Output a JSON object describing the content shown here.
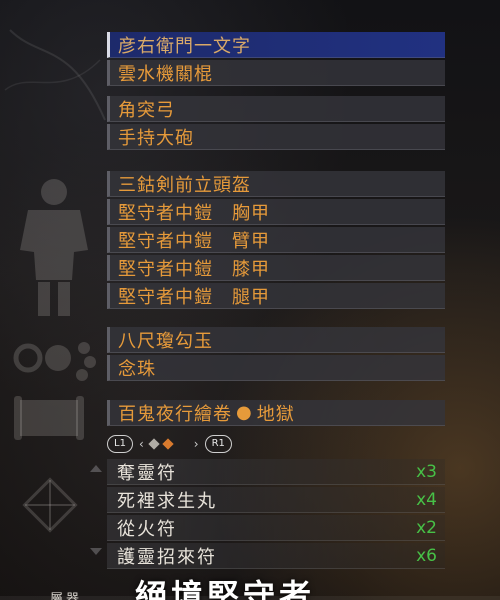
{
  "equipment": {
    "weapons": [
      "彦右衛門一文字",
      "雲水機關棍"
    ],
    "ranged": [
      "角突弓",
      "手持大砲"
    ],
    "armor": [
      "三鈷剣前立頭盔",
      "堅守者中鎧　胸甲",
      "堅守者中鎧　臂甲",
      "堅守者中鎧　膝甲",
      "堅守者中鎧　腿甲"
    ],
    "accessories": [
      "八尺瓊勾玉",
      "念珠"
    ],
    "scroll": {
      "name": "百鬼夜行繪卷",
      "separator": "●",
      "difficulty": "地獄"
    }
  },
  "pager": {
    "left_button": "L1",
    "right_button": "R1",
    "left_arrow": "‹",
    "right_arrow": "›"
  },
  "items": [
    {
      "name": "奪靈符",
      "qty": "x3"
    },
    {
      "name": "死裡求生丸",
      "qty": "x4"
    },
    {
      "name": "從火符",
      "qty": "x2"
    },
    {
      "name": "護靈招來符",
      "qty": "x6"
    }
  ],
  "footer": {
    "small_label": "屬器",
    "set_name": "絕境堅守者"
  },
  "colors": {
    "highlight": "#213181",
    "text_orange": "#e69a3a",
    "qty_green": "#47c147"
  },
  "icons": [
    "armor-icon",
    "accessory-icon",
    "scroll-icon",
    "items-icon"
  ]
}
